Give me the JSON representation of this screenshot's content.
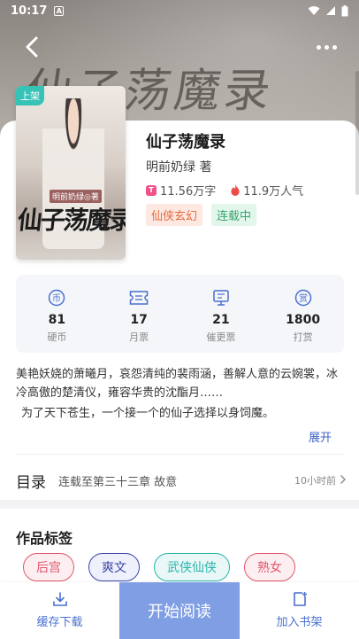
{
  "status_bar": {
    "time": "10:17",
    "notification_glyph": "A"
  },
  "header": {
    "background_title": "仙子荡魔录"
  },
  "book": {
    "cover_badge": "上架",
    "cover_author_text": "明前奶绿◎著",
    "cover_title_text": "仙子荡魔录",
    "title": "仙子荡魔录",
    "author": "明前奶绿 著",
    "word_count": "11.56万字",
    "popularity": "11.9万人气",
    "tags": [
      {
        "label": "仙侠玄幻",
        "style": "orange"
      },
      {
        "label": "连载中",
        "style": "green"
      }
    ]
  },
  "stats": [
    {
      "value": "81",
      "label": "硬币",
      "icon": "coin-icon",
      "glyph": "币"
    },
    {
      "value": "17",
      "label": "月票",
      "icon": "ticket-icon"
    },
    {
      "value": "21",
      "label": "催更票",
      "icon": "urge-update-icon"
    },
    {
      "value": "1800",
      "label": "打赏",
      "icon": "reward-icon",
      "glyph": "赏"
    }
  ],
  "synopsis": {
    "lines": [
      "美艳妖娆的萧曦月，哀怨清纯的裴雨涵，善解人意的云婉裳，冰冷高傲的楚清仪，雍容华贵的沈酯月……",
      "为了天下苍生，一个接一个的仙子选择以身饲魔。"
    ],
    "expand_label": "展开"
  },
  "toc": {
    "title": "目录",
    "latest_chapter": "连载至第三十三章 故意",
    "updated": "10小时前"
  },
  "work_tags": {
    "heading": "作品标签",
    "items": [
      {
        "label": "后宫",
        "color": "#e0566a"
      },
      {
        "label": "爽文",
        "color": "#3d47a8"
      },
      {
        "label": "武侠仙侠",
        "color": "#2bb3ae"
      },
      {
        "label": "熟女",
        "color": "#e0566a"
      }
    ]
  },
  "bottom_bar": {
    "download_label": "缓存下载",
    "read_label": "开始阅读",
    "shelf_label": "加入书架"
  },
  "colors": {
    "accent": "#4a6fd0",
    "read_button": "#7f9ee3",
    "badge": "#37c2b6"
  }
}
